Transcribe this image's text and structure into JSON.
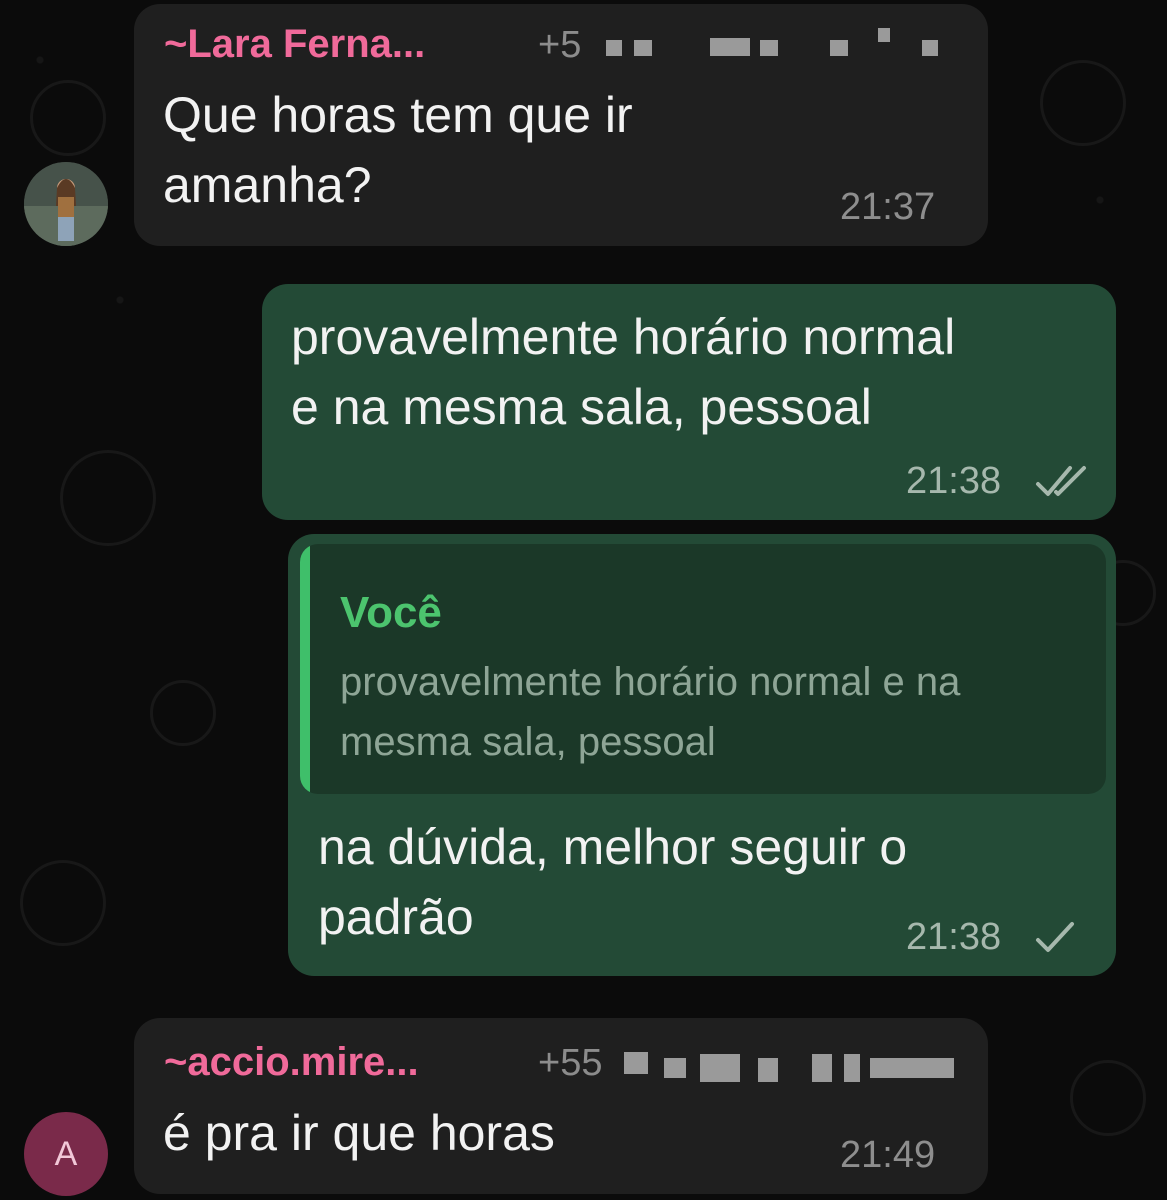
{
  "messages": [
    {
      "sender": "~Lara Ferna...",
      "phone_prefix": "+5",
      "text_line1": "Que horas tem que ir",
      "text_line2": "amanha?",
      "time": "21:37"
    },
    {
      "text_line1": "provavelmente horário normal",
      "text_line2": "e na mesma sala, pessoal",
      "time": "21:38",
      "status": "read",
      "status_icon": "double-check-icon"
    },
    {
      "quote_author": "Você",
      "quote_line1": "provavelmente horário normal e na",
      "quote_line2": "mesma sala, pessoal",
      "text_line1": "na dúvida, melhor seguir o",
      "text_line2": "padrão",
      "time": "21:38",
      "status": "sent",
      "status_icon": "single-check-icon"
    },
    {
      "sender": "~accio.mire...",
      "phone_prefix": "+55",
      "avatar_letter": "A",
      "text_line1": "é pra ir que horas",
      "time": "21:49"
    }
  ],
  "colors": {
    "background": "#0b0b0b",
    "incoming_bubble": "#1f1f1f",
    "outgoing_bubble": "#234a36",
    "sender_name": "#f06a9a",
    "quote_accent": "#3fbf6a",
    "avatar_a": "#7a2a4a"
  }
}
